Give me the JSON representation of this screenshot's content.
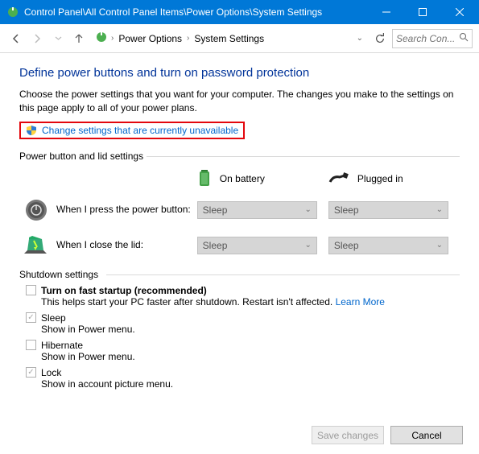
{
  "titlebar": {
    "path": "Control Panel\\All Control Panel Items\\Power Options\\System Settings"
  },
  "breadcrumb": {
    "items": [
      "Power Options",
      "System Settings"
    ]
  },
  "search": {
    "placeholder": "Search Con..."
  },
  "page": {
    "title": "Define power buttons and turn on password protection",
    "desc": "Choose the power settings that you want for your computer. The changes you make to the settings on this page apply to all of your power plans.",
    "admin_link": "Change settings that are currently unavailable"
  },
  "pbl": {
    "section_label": "Power button and lid settings",
    "col_battery": "On battery",
    "col_plugged": "Plugged in",
    "rows": [
      {
        "label": "When I press the power button:",
        "battery": "Sleep",
        "plugged": "Sleep"
      },
      {
        "label": "When I close the lid:",
        "battery": "Sleep",
        "plugged": "Sleep"
      }
    ]
  },
  "shutdown": {
    "section_label": "Shutdown settings",
    "items": [
      {
        "label": "Turn on fast startup (recommended)",
        "strong": true,
        "checked": false,
        "sub": "This helps start your PC faster after shutdown. Restart isn't affected.",
        "learn_more": "Learn More"
      },
      {
        "label": "Sleep",
        "strong": false,
        "checked": true,
        "sub": "Show in Power menu."
      },
      {
        "label": "Hibernate",
        "strong": false,
        "checked": false,
        "sub": "Show in Power menu."
      },
      {
        "label": "Lock",
        "strong": false,
        "checked": true,
        "sub": "Show in account picture menu."
      }
    ]
  },
  "footer": {
    "save": "Save changes",
    "cancel": "Cancel"
  }
}
